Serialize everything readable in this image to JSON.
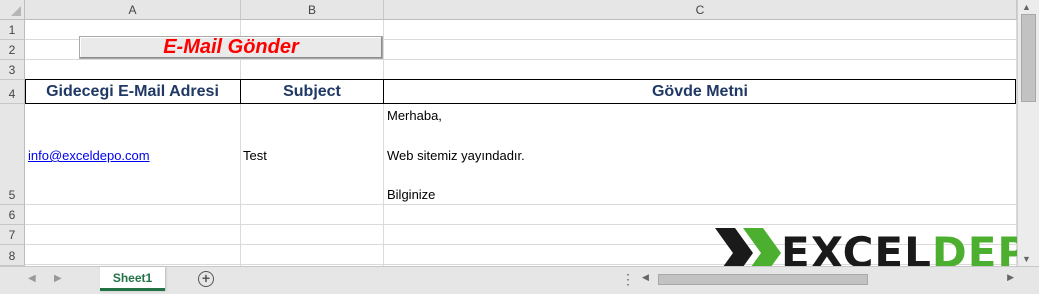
{
  "columns": [
    "A",
    "B",
    "C"
  ],
  "rows": [
    "1",
    "2",
    "3",
    "4",
    "5",
    "6",
    "7",
    "8"
  ],
  "macro_button": {
    "label": "E-Mail Gönder"
  },
  "headers": {
    "a": "Gidecegi E-Mail Adresi",
    "b": "Subject",
    "c": "Gövde Metni"
  },
  "row5": {
    "email": "info@exceldepo.com",
    "subject": "Test",
    "body_line1": "Merhaba,",
    "body_line2": "Web sitemiz yayındadır.",
    "body_line3": "Bilginize"
  },
  "sheet_tabs": [
    {
      "label": "Sheet1",
      "active": true
    }
  ],
  "logo": {
    "part1": "EXCEL",
    "part2": "DEPO"
  },
  "colors": {
    "header_text": "#1f3864",
    "button_text": "#ff0000",
    "link": "#0000ee",
    "tab_accent": "#217346",
    "logo_green": "#4caf2f"
  }
}
